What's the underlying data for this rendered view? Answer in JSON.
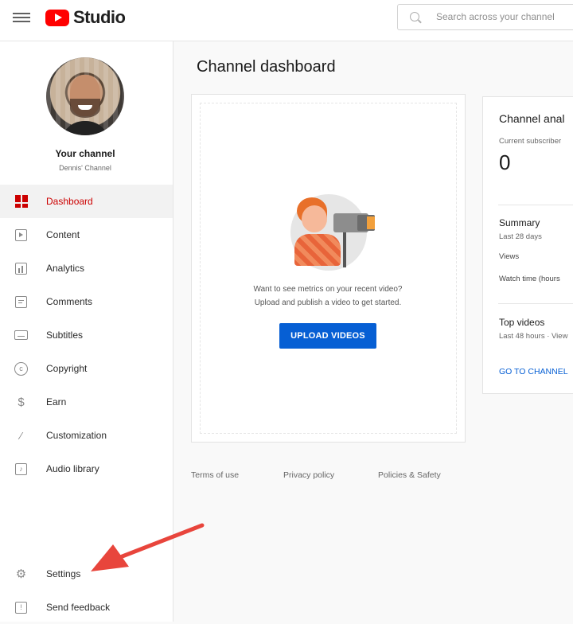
{
  "header": {
    "logo_text": "Studio",
    "search_placeholder": "Search across your channel"
  },
  "sidebar": {
    "channel_title": "Your channel",
    "channel_name": "Dennis' Channel",
    "items": [
      {
        "label": "Dashboard",
        "icon": "dashboard-icon",
        "active": true
      },
      {
        "label": "Content",
        "icon": "content-icon"
      },
      {
        "label": "Analytics",
        "icon": "analytics-icon"
      },
      {
        "label": "Comments",
        "icon": "comments-icon"
      },
      {
        "label": "Subtitles",
        "icon": "subtitles-icon"
      },
      {
        "label": "Copyright",
        "icon": "copyright-icon"
      },
      {
        "label": "Earn",
        "icon": "dollar-icon"
      },
      {
        "label": "Customization",
        "icon": "magic-wand-icon"
      },
      {
        "label": "Audio library",
        "icon": "audio-library-icon"
      }
    ],
    "bottom_items": [
      {
        "label": "Settings",
        "icon": "gear-icon"
      },
      {
        "label": "Send feedback",
        "icon": "feedback-icon"
      }
    ]
  },
  "main": {
    "title": "Channel dashboard",
    "upload_card": {
      "message_line1": "Want to see metrics on your recent video?",
      "message_line2": "Upload and publish a video to get started.",
      "button_label": "UPLOAD VIDEOS"
    },
    "analytics_card": {
      "title": "Channel anal",
      "subscribers_label": "Current subscriber",
      "subscribers_value": "0",
      "summary_title": "Summary",
      "summary_period": "Last 28 days",
      "views_label": "Views",
      "watch_time_label": "Watch time (hours",
      "top_videos_title": "Top videos",
      "top_videos_period": "Last 48 hours · View",
      "link_label": "GO TO CHANNEL"
    },
    "footer_links": [
      "Terms of use",
      "Privacy policy",
      "Policies & Safety"
    ]
  },
  "colors": {
    "brand_red": "#ff0000",
    "active_red": "#cc0000",
    "button_blue": "#065fd4",
    "annotation_arrow": "#e8453c"
  }
}
